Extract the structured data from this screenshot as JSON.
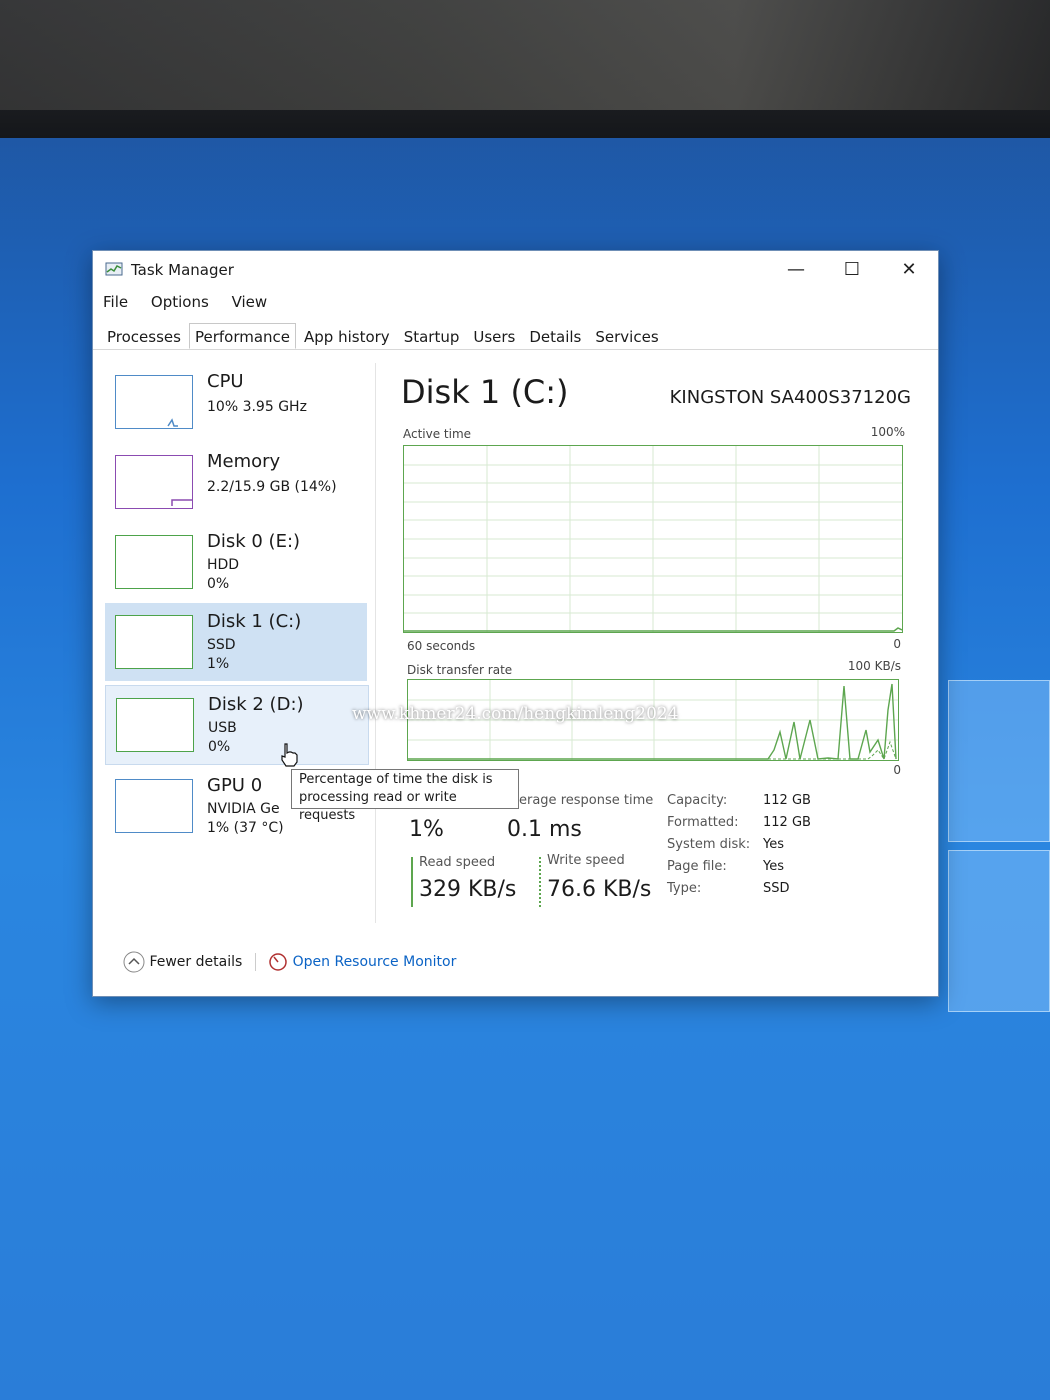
{
  "window": {
    "title": "Task Manager",
    "minimize_glyph": "—",
    "maximize_glyph": "☐",
    "close_glyph": "✕"
  },
  "menu": [
    "File",
    "Options",
    "View"
  ],
  "tabs": [
    "Processes",
    "Performance",
    "App history",
    "Startup",
    "Users",
    "Details",
    "Services"
  ],
  "active_tab": "Performance",
  "sidebar": {
    "cpu": {
      "name": "CPU",
      "line1": "10% 3.95 GHz"
    },
    "memory": {
      "name": "Memory",
      "line1": "2.2/15.9 GB (14%)"
    },
    "disk0": {
      "name": "Disk 0 (E:)",
      "line1": "HDD",
      "line2": "0%"
    },
    "disk1": {
      "name": "Disk 1 (C:)",
      "line1": "SSD",
      "line2": "1%"
    },
    "disk2": {
      "name": "Disk 2 (D:)",
      "line1": "USB",
      "line2": "0%"
    },
    "gpu": {
      "name": "GPU 0",
      "line1": "NVIDIA Ge",
      "line2": "1% (37 °C)"
    }
  },
  "main": {
    "title": "Disk 1 (C:)",
    "model": "KINGSTON SA400S37120G",
    "active_time_label": "Active time",
    "active_time_max": "100%",
    "seconds_label": "60 seconds",
    "zero_label": "0",
    "transfer_label": "Disk transfer rate",
    "transfer_max": "100 KB/s",
    "transfer_zero": "0",
    "avg_response_label": "erage response time",
    "active_value": "1%",
    "avg_response_value": "0.1 ms",
    "read_label": "Read speed",
    "read_value": "329 KB/s",
    "write_label": "Write speed",
    "write_value": "76.6 KB/s",
    "props": [
      {
        "key": "Capacity:",
        "value": "112 GB"
      },
      {
        "key": "Formatted:",
        "value": "112 GB"
      },
      {
        "key": "System disk:",
        "value": "Yes"
      },
      {
        "key": "Page file:",
        "value": "Yes"
      },
      {
        "key": "Type:",
        "value": "SSD"
      }
    ]
  },
  "tooltip": {
    "line1": "Percentage of time the disk is",
    "line2": "processing read or write requests"
  },
  "footer": {
    "fewer_details": "Fewer details",
    "open_resource_monitor": "Open Resource Monitor"
  },
  "watermark": "www.khmer24.com/hengkimleng2024",
  "colors": {
    "accent_green": "#5da64f",
    "cpu_blue": "#4f8bc7",
    "memory_purple": "#8b4bb1",
    "link_blue": "#0b63c5",
    "selected_bg": "#cfe1f3"
  }
}
